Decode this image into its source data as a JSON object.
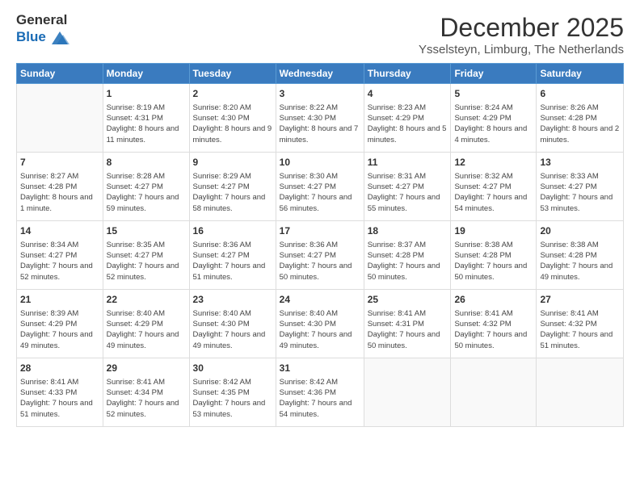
{
  "logo": {
    "line1": "General",
    "line2": "Blue"
  },
  "title": "December 2025",
  "location": "Ysselsteyn, Limburg, The Netherlands",
  "weekdays": [
    "Sunday",
    "Monday",
    "Tuesday",
    "Wednesday",
    "Thursday",
    "Friday",
    "Saturday"
  ],
  "weeks": [
    [
      {
        "day": "",
        "sunrise": "",
        "sunset": "",
        "daylight": ""
      },
      {
        "day": "1",
        "sunrise": "Sunrise: 8:19 AM",
        "sunset": "Sunset: 4:31 PM",
        "daylight": "Daylight: 8 hours and 11 minutes."
      },
      {
        "day": "2",
        "sunrise": "Sunrise: 8:20 AM",
        "sunset": "Sunset: 4:30 PM",
        "daylight": "Daylight: 8 hours and 9 minutes."
      },
      {
        "day": "3",
        "sunrise": "Sunrise: 8:22 AM",
        "sunset": "Sunset: 4:30 PM",
        "daylight": "Daylight: 8 hours and 7 minutes."
      },
      {
        "day": "4",
        "sunrise": "Sunrise: 8:23 AM",
        "sunset": "Sunset: 4:29 PM",
        "daylight": "Daylight: 8 hours and 5 minutes."
      },
      {
        "day": "5",
        "sunrise": "Sunrise: 8:24 AM",
        "sunset": "Sunset: 4:29 PM",
        "daylight": "Daylight: 8 hours and 4 minutes."
      },
      {
        "day": "6",
        "sunrise": "Sunrise: 8:26 AM",
        "sunset": "Sunset: 4:28 PM",
        "daylight": "Daylight: 8 hours and 2 minutes."
      }
    ],
    [
      {
        "day": "7",
        "sunrise": "Sunrise: 8:27 AM",
        "sunset": "Sunset: 4:28 PM",
        "daylight": "Daylight: 8 hours and 1 minute."
      },
      {
        "day": "8",
        "sunrise": "Sunrise: 8:28 AM",
        "sunset": "Sunset: 4:27 PM",
        "daylight": "Daylight: 7 hours and 59 minutes."
      },
      {
        "day": "9",
        "sunrise": "Sunrise: 8:29 AM",
        "sunset": "Sunset: 4:27 PM",
        "daylight": "Daylight: 7 hours and 58 minutes."
      },
      {
        "day": "10",
        "sunrise": "Sunrise: 8:30 AM",
        "sunset": "Sunset: 4:27 PM",
        "daylight": "Daylight: 7 hours and 56 minutes."
      },
      {
        "day": "11",
        "sunrise": "Sunrise: 8:31 AM",
        "sunset": "Sunset: 4:27 PM",
        "daylight": "Daylight: 7 hours and 55 minutes."
      },
      {
        "day": "12",
        "sunrise": "Sunrise: 8:32 AM",
        "sunset": "Sunset: 4:27 PM",
        "daylight": "Daylight: 7 hours and 54 minutes."
      },
      {
        "day": "13",
        "sunrise": "Sunrise: 8:33 AM",
        "sunset": "Sunset: 4:27 PM",
        "daylight": "Daylight: 7 hours and 53 minutes."
      }
    ],
    [
      {
        "day": "14",
        "sunrise": "Sunrise: 8:34 AM",
        "sunset": "Sunset: 4:27 PM",
        "daylight": "Daylight: 7 hours and 52 minutes."
      },
      {
        "day": "15",
        "sunrise": "Sunrise: 8:35 AM",
        "sunset": "Sunset: 4:27 PM",
        "daylight": "Daylight: 7 hours and 52 minutes."
      },
      {
        "day": "16",
        "sunrise": "Sunrise: 8:36 AM",
        "sunset": "Sunset: 4:27 PM",
        "daylight": "Daylight: 7 hours and 51 minutes."
      },
      {
        "day": "17",
        "sunrise": "Sunrise: 8:36 AM",
        "sunset": "Sunset: 4:27 PM",
        "daylight": "Daylight: 7 hours and 50 minutes."
      },
      {
        "day": "18",
        "sunrise": "Sunrise: 8:37 AM",
        "sunset": "Sunset: 4:28 PM",
        "daylight": "Daylight: 7 hours and 50 minutes."
      },
      {
        "day": "19",
        "sunrise": "Sunrise: 8:38 AM",
        "sunset": "Sunset: 4:28 PM",
        "daylight": "Daylight: 7 hours and 50 minutes."
      },
      {
        "day": "20",
        "sunrise": "Sunrise: 8:38 AM",
        "sunset": "Sunset: 4:28 PM",
        "daylight": "Daylight: 7 hours and 49 minutes."
      }
    ],
    [
      {
        "day": "21",
        "sunrise": "Sunrise: 8:39 AM",
        "sunset": "Sunset: 4:29 PM",
        "daylight": "Daylight: 7 hours and 49 minutes."
      },
      {
        "day": "22",
        "sunrise": "Sunrise: 8:40 AM",
        "sunset": "Sunset: 4:29 PM",
        "daylight": "Daylight: 7 hours and 49 minutes."
      },
      {
        "day": "23",
        "sunrise": "Sunrise: 8:40 AM",
        "sunset": "Sunset: 4:30 PM",
        "daylight": "Daylight: 7 hours and 49 minutes."
      },
      {
        "day": "24",
        "sunrise": "Sunrise: 8:40 AM",
        "sunset": "Sunset: 4:30 PM",
        "daylight": "Daylight: 7 hours and 49 minutes."
      },
      {
        "day": "25",
        "sunrise": "Sunrise: 8:41 AM",
        "sunset": "Sunset: 4:31 PM",
        "daylight": "Daylight: 7 hours and 50 minutes."
      },
      {
        "day": "26",
        "sunrise": "Sunrise: 8:41 AM",
        "sunset": "Sunset: 4:32 PM",
        "daylight": "Daylight: 7 hours and 50 minutes."
      },
      {
        "day": "27",
        "sunrise": "Sunrise: 8:41 AM",
        "sunset": "Sunset: 4:32 PM",
        "daylight": "Daylight: 7 hours and 51 minutes."
      }
    ],
    [
      {
        "day": "28",
        "sunrise": "Sunrise: 8:41 AM",
        "sunset": "Sunset: 4:33 PM",
        "daylight": "Daylight: 7 hours and 51 minutes."
      },
      {
        "day": "29",
        "sunrise": "Sunrise: 8:41 AM",
        "sunset": "Sunset: 4:34 PM",
        "daylight": "Daylight: 7 hours and 52 minutes."
      },
      {
        "day": "30",
        "sunrise": "Sunrise: 8:42 AM",
        "sunset": "Sunset: 4:35 PM",
        "daylight": "Daylight: 7 hours and 53 minutes."
      },
      {
        "day": "31",
        "sunrise": "Sunrise: 8:42 AM",
        "sunset": "Sunset: 4:36 PM",
        "daylight": "Daylight: 7 hours and 54 minutes."
      },
      {
        "day": "",
        "sunrise": "",
        "sunset": "",
        "daylight": ""
      },
      {
        "day": "",
        "sunrise": "",
        "sunset": "",
        "daylight": ""
      },
      {
        "day": "",
        "sunrise": "",
        "sunset": "",
        "daylight": ""
      }
    ]
  ]
}
